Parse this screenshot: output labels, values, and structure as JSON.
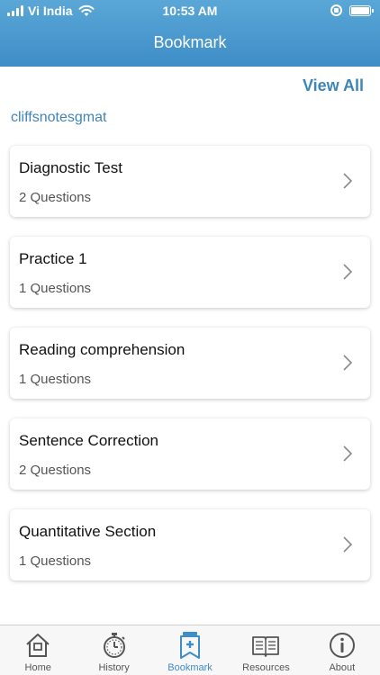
{
  "status": {
    "carrier": "Vi India",
    "time": "10:53 AM"
  },
  "header": {
    "title": "Bookmark"
  },
  "view_all_label": "View All",
  "section_name": "cliffsnotesgmat",
  "bookmarks": [
    {
      "title": "Diagnostic Test",
      "count": "2 Questions"
    },
    {
      "title": "Practice 1",
      "count": "1 Questions"
    },
    {
      "title": "Reading comprehension",
      "count": "1 Questions"
    },
    {
      "title": "Sentence Correction",
      "count": "2 Questions"
    },
    {
      "title": "Quantitative Section",
      "count": "1 Questions"
    }
  ],
  "tabs": [
    {
      "label": "Home",
      "icon": "home-icon"
    },
    {
      "label": "History",
      "icon": "stopwatch-icon"
    },
    {
      "label": "Bookmark",
      "icon": "bookmark-icon",
      "active": true
    },
    {
      "label": "Resources",
      "icon": "book-icon"
    },
    {
      "label": "About",
      "icon": "info-icon"
    }
  ],
  "colors": {
    "accent": "#3e8dc6",
    "header_top": "#5aa7d7",
    "link": "#3e86b8",
    "icon_gray": "#555555"
  }
}
